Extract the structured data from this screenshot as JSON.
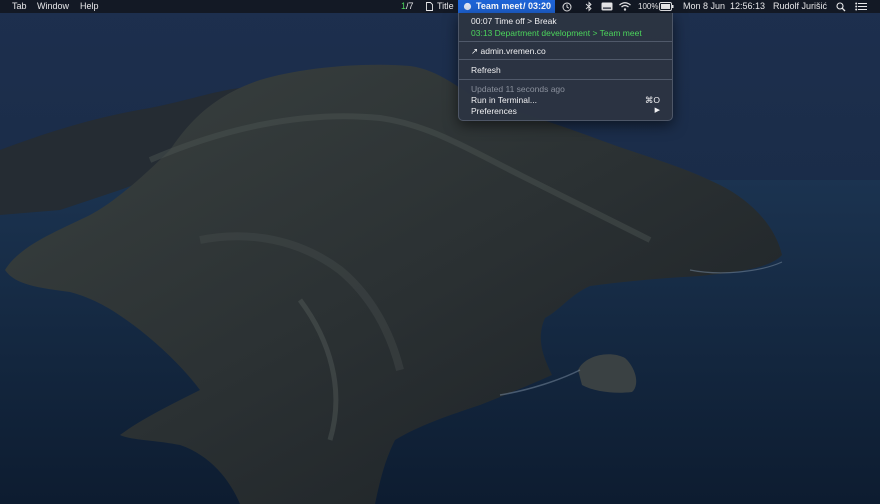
{
  "menubar": {
    "menus": [
      "Tab",
      "Window",
      "Help"
    ],
    "counter_current": "1",
    "counter_total": "/7",
    "doc_title": "Title",
    "timer": {
      "name": "Team meet",
      "elapsed": "/ 03:20"
    },
    "battery_percent": "100%",
    "date": "Mon 8 Jun",
    "time": "12:56:13",
    "user": "Rudolf Jurišić",
    "icons": [
      "timer-icon",
      "history-icon",
      "bluetooth-icon",
      "keyboard-icon",
      "wifi-icon",
      "battery-icon",
      "search-icon",
      "notification-center-icon"
    ]
  },
  "dropdown": {
    "entry1": {
      "time": "00:07",
      "label": "Time off > Break"
    },
    "entry2": {
      "time": "03:13",
      "label": "Department development > Team meet"
    },
    "link": "admin.vremen.co",
    "refresh": "Refresh",
    "updated": "Updated 11 seconds ago",
    "terminal": "Run in Terminal...",
    "terminal_shortcut": "⌘O",
    "preferences": "Preferences",
    "submenu_arrow": "▶"
  },
  "colors": {
    "menubar_bg": "#12182a",
    "accent": "#1e64d6",
    "green": "#4cd65c"
  }
}
